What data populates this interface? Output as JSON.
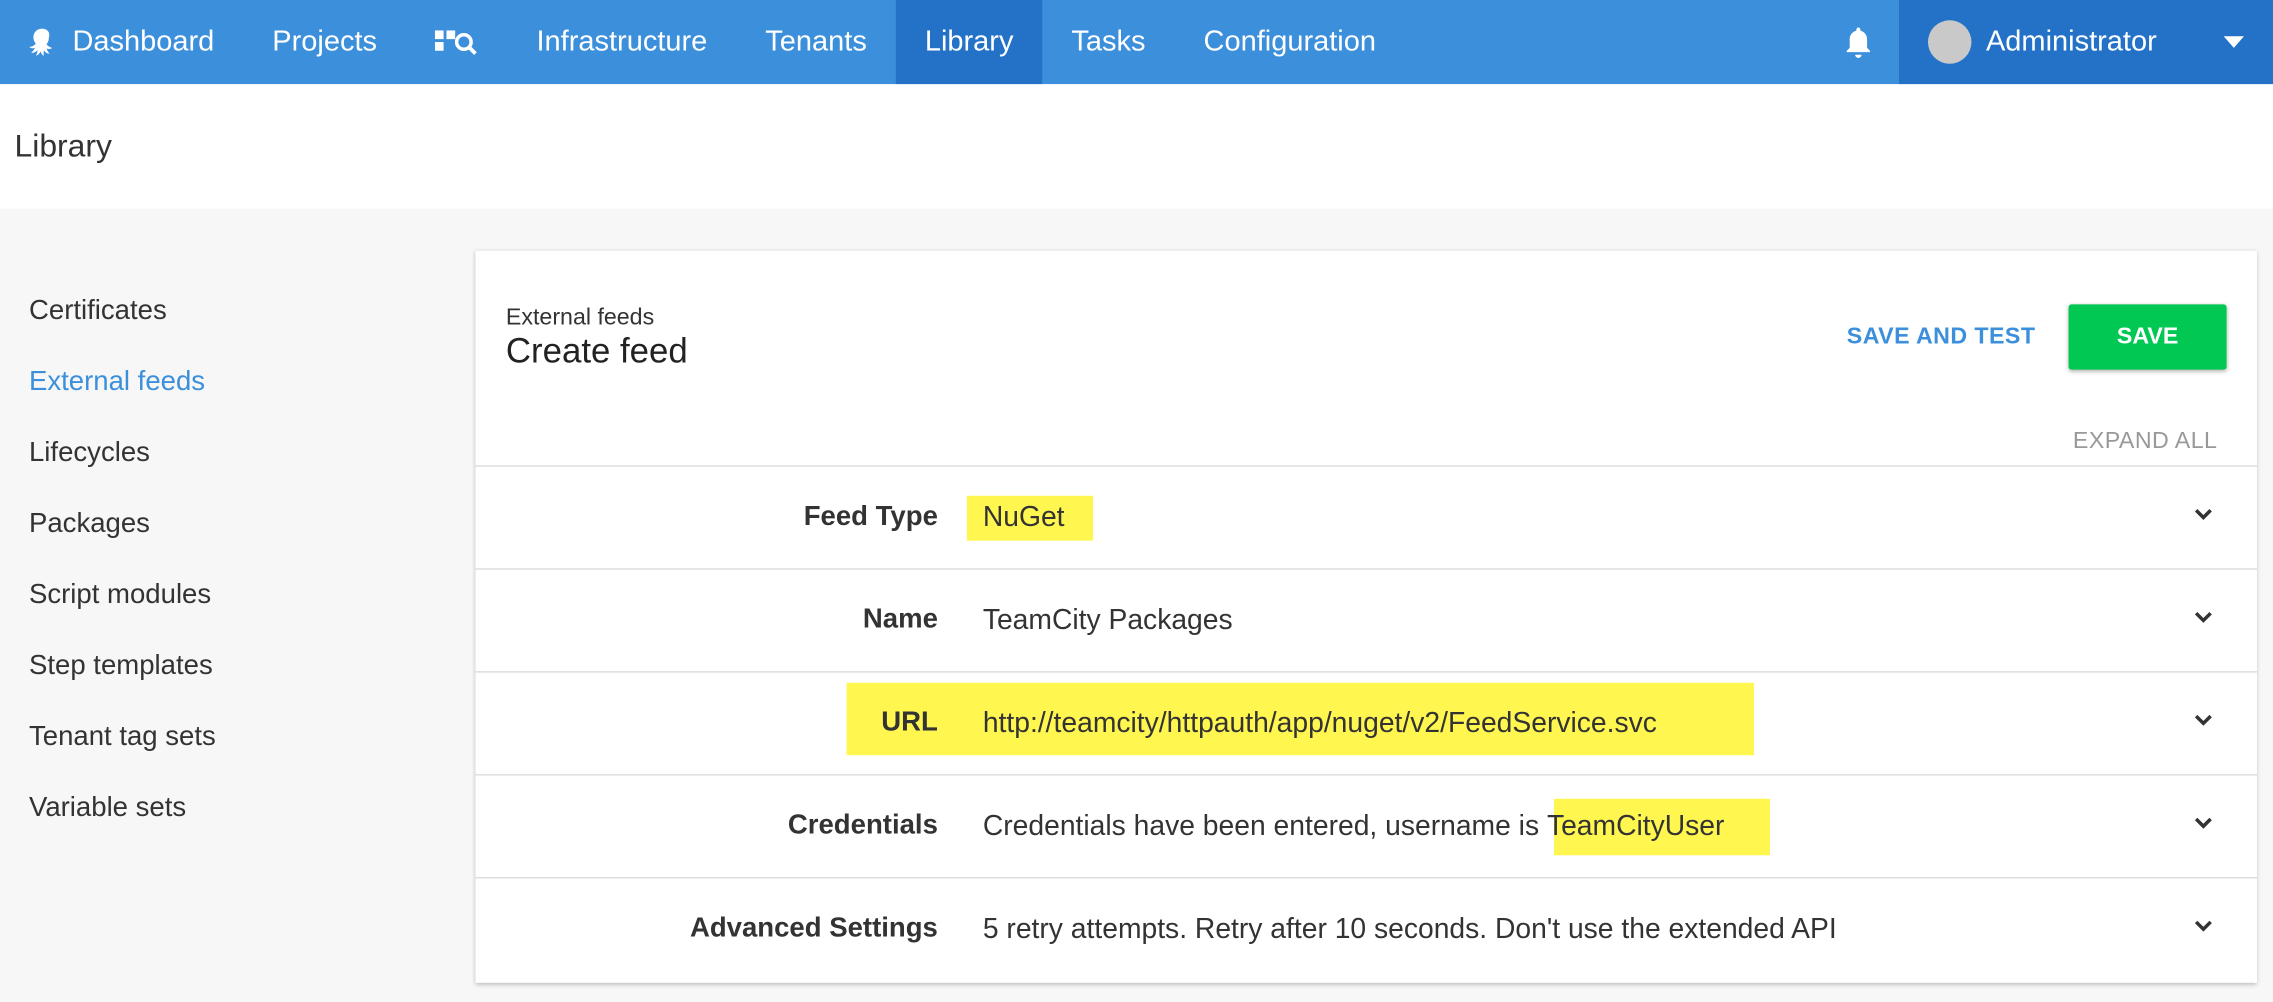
{
  "nav": {
    "items": [
      {
        "label": "Dashboard",
        "name": "nav-dashboard"
      },
      {
        "label": "Projects",
        "name": "nav-projects"
      },
      {
        "label": "Infrastructure",
        "name": "nav-infrastructure"
      },
      {
        "label": "Tenants",
        "name": "nav-tenants"
      },
      {
        "label": "Library",
        "name": "nav-library",
        "active": true
      },
      {
        "label": "Tasks",
        "name": "nav-tasks"
      },
      {
        "label": "Configuration",
        "name": "nav-configuration"
      }
    ],
    "search_icon": "search-dashboard-icon",
    "bell_icon": "bell-icon",
    "user_name": "Administrator"
  },
  "page": {
    "title": "Library"
  },
  "sidebar": {
    "items": [
      {
        "label": "Certificates"
      },
      {
        "label": "External feeds",
        "active": true
      },
      {
        "label": "Lifecycles"
      },
      {
        "label": "Packages"
      },
      {
        "label": "Script modules"
      },
      {
        "label": "Step templates"
      },
      {
        "label": "Tenant tag sets"
      },
      {
        "label": "Variable sets"
      }
    ]
  },
  "card": {
    "breadcrumb": "External feeds",
    "title": "Create feed",
    "save_and_test_label": "SAVE AND TEST",
    "save_label": "SAVE",
    "expand_all_label": "EXPAND ALL",
    "rows": [
      {
        "label": "Feed Type",
        "value": "NuGet"
      },
      {
        "label": "Name",
        "value": "TeamCity Packages"
      },
      {
        "label": "URL",
        "value": "http://teamcity/httpauth/app/nuget/v2/FeedService.svc"
      },
      {
        "label": "Credentials",
        "value_prefix": "Credentials have been entered, username is ",
        "value_user": "TeamCityUser"
      },
      {
        "label": "Advanced Settings",
        "value": "5 retry attempts. Retry after 10 seconds. Don't use the extended API"
      }
    ]
  },
  "colors": {
    "nav_bg": "#3b8fdb",
    "nav_active": "#2472c8",
    "save_button": "#00c853",
    "highlight": "#fff64f",
    "link": "#3b8fdb"
  }
}
